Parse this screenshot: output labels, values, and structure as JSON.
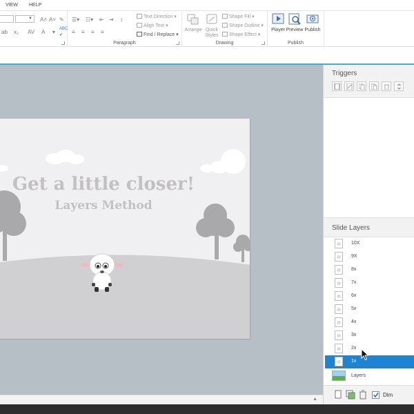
{
  "menu": {
    "items": [
      "VIEW",
      "HELP"
    ]
  },
  "ribbon": {
    "paragraph": {
      "label": "Paragraph",
      "text_direction": "Text Direction",
      "align_text": "Align Text",
      "find_replace": "Find / Replace"
    },
    "drawing": {
      "label": "Drawing",
      "arrange": "Arrange",
      "quick_styles": "Quick Styles",
      "shape_fill": "Shape Fill",
      "shape_outline": "Shape Outline",
      "shape_effect": "Shape Effect"
    },
    "publish": {
      "label": "Publish",
      "player": "Player",
      "preview": "Preview",
      "publish_btn": "Publish"
    }
  },
  "slide": {
    "title": "Get a little closer!",
    "subtitle": "Layers Method"
  },
  "triggers": {
    "title": "Triggers"
  },
  "slide_layers": {
    "title": "Slide Layers",
    "layers": [
      {
        "name": "10X",
        "selected": false
      },
      {
        "name": "9X",
        "selected": false
      },
      {
        "name": "8x",
        "selected": false
      },
      {
        "name": "7x",
        "selected": false
      },
      {
        "name": "6x",
        "selected": false
      },
      {
        "name": "5x",
        "selected": false
      },
      {
        "name": "4x",
        "selected": false
      },
      {
        "name": "3x",
        "selected": false
      },
      {
        "name": "2x",
        "selected": false
      },
      {
        "name": "1x",
        "selected": true
      }
    ],
    "base_layer": "Layers",
    "dim_label": "Dim",
    "dim_checked": true
  },
  "colors": {
    "accent": "#1d84d4",
    "canvas_bg": "#b6bec6",
    "slide_bg": "#f0eff1",
    "title_gray": "#c2c0c2"
  }
}
